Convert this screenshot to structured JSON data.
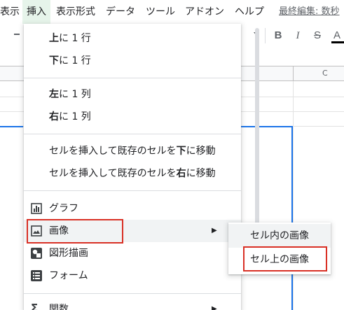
{
  "menubar": {
    "items": [
      "表示",
      "挿入",
      "表示形式",
      "データ",
      "ツール",
      "アドオン",
      "ヘルプ"
    ],
    "active_index": 1,
    "last_edit": "最終編集: 数秒"
  },
  "toolbar": {
    "bold": "B",
    "italic": "I",
    "strike": "S",
    "text_color": "A"
  },
  "grid": {
    "column_label": "C"
  },
  "insert_menu": {
    "row_above": {
      "bold": "上",
      "rest": "に 1 行"
    },
    "row_below": {
      "bold": "下",
      "rest": "に 1 行"
    },
    "col_left": {
      "bold": "左",
      "rest": "に 1 列"
    },
    "col_right": {
      "bold": "右",
      "rest": "に 1 列"
    },
    "cells_down": {
      "pre": "セルを挿入して既存のセルを",
      "bold": "下",
      "post": "に移動"
    },
    "cells_right": {
      "pre": "セルを挿入して既存のセルを",
      "bold": "右",
      "post": "に移動"
    },
    "chart": "グラフ",
    "image": "画像",
    "drawing": "図形描画",
    "form": "フォーム",
    "function": "関数",
    "submenu_arrow": "▶"
  },
  "image_submenu": {
    "in_cell": "セル内の画像",
    "over_cells": "セル上の画像"
  },
  "colors": {
    "highlight": "#d93025",
    "selection": "#1a73e8",
    "active_menu": "#e6f4ea"
  }
}
